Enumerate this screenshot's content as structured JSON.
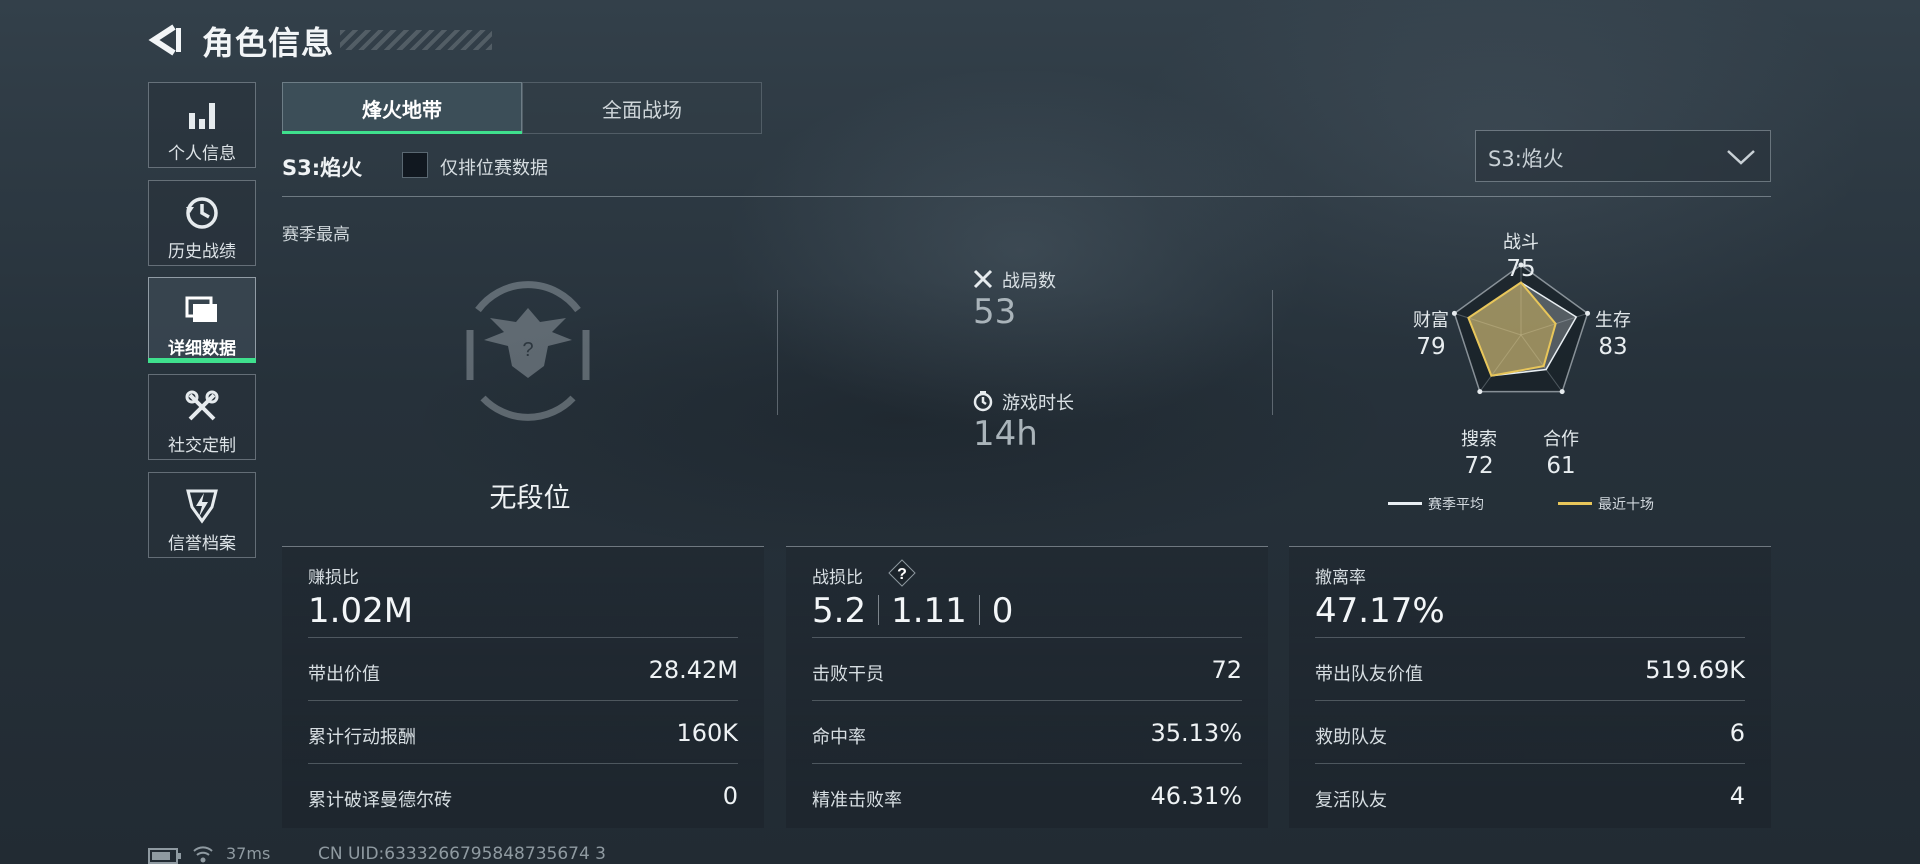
{
  "header": {
    "title": "角色信息"
  },
  "sidebar": {
    "items": [
      {
        "label": "个人信息",
        "icon": "bar-chart-icon"
      },
      {
        "label": "历史战绩",
        "icon": "history-clock-icon"
      },
      {
        "label": "详细数据",
        "icon": "folder-icon",
        "active": true
      },
      {
        "label": "社交定制",
        "icon": "tools-icon"
      },
      {
        "label": "信誉档案",
        "icon": "shield-lightning-icon"
      }
    ]
  },
  "tabs": [
    {
      "label": "烽火地带",
      "active": true
    },
    {
      "label": "全面战场",
      "active": false
    }
  ],
  "filter": {
    "season_label": "S3:焰火",
    "ranked_only_label": "仅排位赛数据",
    "ranked_only_checked": false,
    "season_select_value": "S3:焰火"
  },
  "overview": {
    "season_best_label": "赛季最高",
    "rank_text": "无段位",
    "matches_label": "战局数",
    "matches_value": "53",
    "playtime_label": "游戏时长",
    "playtime_value": "14h"
  },
  "radar": {
    "axes": [
      {
        "label": "战斗",
        "value": "75"
      },
      {
        "label": "生存",
        "value": "83"
      },
      {
        "label": "合作",
        "value": "61"
      },
      {
        "label": "搜索",
        "value": "72"
      },
      {
        "label": "财富",
        "value": "79"
      }
    ],
    "season_avg": [
      75,
      83,
      61,
      72,
      79
    ],
    "recent_ten": [
      75,
      52,
      55,
      72,
      79
    ],
    "legend": {
      "season_avg": "赛季平均",
      "recent": "最近十场"
    },
    "colors": {
      "season_avg": "#e8eef2",
      "recent": "#e8c65a"
    }
  },
  "panels": [
    {
      "title": "赚损比",
      "main": "1.02M",
      "rows": [
        {
          "k": "带出价值",
          "v": "28.42M"
        },
        {
          "k": "累计行动报酬",
          "v": "160K"
        },
        {
          "k": "累计破译曼德尔砖",
          "v": "0"
        }
      ]
    },
    {
      "title": "战损比",
      "main_parts": [
        "5.2",
        "1.11",
        "0"
      ],
      "rows": [
        {
          "k": "击败干员",
          "v": "72"
        },
        {
          "k": "命中率",
          "v": "35.13%"
        },
        {
          "k": "精准击败率",
          "v": "46.31%"
        }
      ]
    },
    {
      "title": "撤离率",
      "main": "47.17%",
      "rows": [
        {
          "k": "带出队友价值",
          "v": "519.69K"
        },
        {
          "k": "救助队友",
          "v": "6"
        },
        {
          "k": "复活队友",
          "v": "4"
        }
      ]
    }
  ],
  "footer": {
    "ping": "37ms",
    "uid": "CN UID:6333266795848735674 3"
  },
  "colors": {
    "accent": "#3fe08d"
  }
}
